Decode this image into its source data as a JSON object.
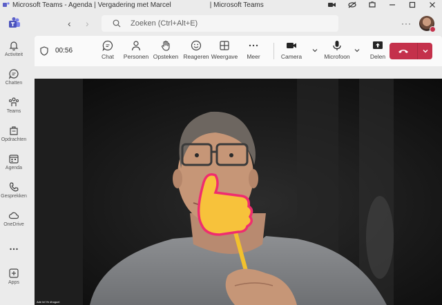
{
  "window": {
    "title": "Microsoft Teams - Agenda | Vergadering met Marcel",
    "title_suffix": "| Microsoft Teams"
  },
  "header": {
    "search_placeholder": "Zoeken (Ctrl+Alt+E)",
    "more": "···"
  },
  "rail": {
    "items": [
      {
        "label": "Activiteit",
        "icon": "bell-icon"
      },
      {
        "label": "Chatten",
        "icon": "chat-icon"
      },
      {
        "label": "Teams",
        "icon": "teams-icon"
      },
      {
        "label": "Opdrachten",
        "icon": "assignments-icon"
      },
      {
        "label": "Agenda",
        "icon": "calendar-icon"
      },
      {
        "label": "Gesprekken",
        "icon": "phone-icon"
      },
      {
        "label": "OneDrive",
        "icon": "cloud-icon"
      },
      {
        "label": "",
        "icon": "more-icon"
      },
      {
        "label": "Apps",
        "icon": "apps-icon"
      }
    ]
  },
  "meeting": {
    "timer": "00:56",
    "buttons": {
      "chat": "Chat",
      "people": "Personen",
      "raise": "Opsteken",
      "react": "Reageren",
      "view": "Weergave",
      "more": "Meer",
      "camera": "Camera",
      "mic": "Microfoon",
      "share": "Delen"
    },
    "video_caption": "Ade tel Ye dhoguei"
  },
  "colors": {
    "accent": "#5b5fc7",
    "leave": "#c4314b",
    "background": "#ebebeb"
  }
}
